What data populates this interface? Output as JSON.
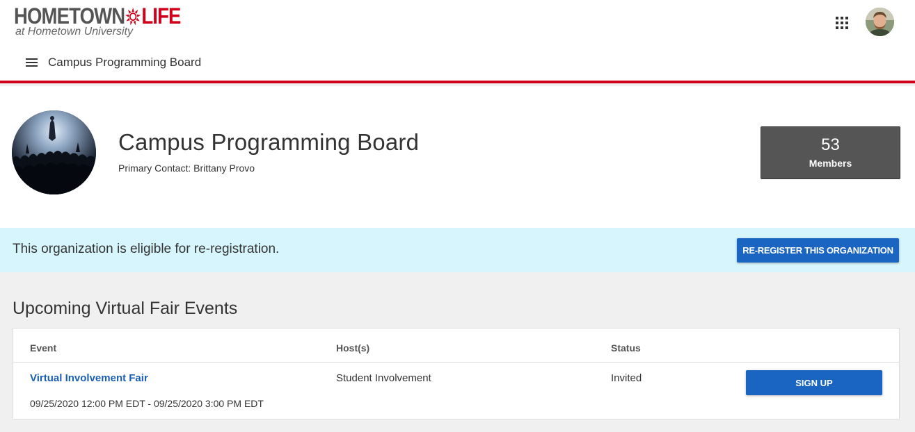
{
  "header": {
    "logo": {
      "word_left": "HOMETOWN",
      "word_right": "LIFE",
      "tagline": "at Hometown University"
    },
    "apps_icon": "grid-apps-icon",
    "avatar_icon": "user-avatar"
  },
  "nav": {
    "menu_icon": "hamburger-menu-icon",
    "title": "Campus Programming Board"
  },
  "organization": {
    "name": "Campus Programming Board",
    "primary_contact": "Primary Contact: Brittany Provo",
    "members": {
      "count": "53",
      "label": "Members"
    }
  },
  "banner": {
    "message": "This organization is eligible for re-registration.",
    "button_label": "RE-REGISTER THIS ORGANIZATION"
  },
  "events": {
    "title": "Upcoming Virtual Fair Events",
    "columns": [
      "Event",
      "Host(s)",
      "Status"
    ],
    "rows": [
      {
        "event": "Virtual Involvement Fair",
        "dates": "09/25/2020 12:00 PM EDT - 09/25/2020 3:00 PM EDT",
        "host": "Student Involvement",
        "status": "Invited",
        "action": "SIGN UP"
      }
    ]
  },
  "colors": {
    "accent_red": "#d0021b",
    "primary_blue": "#1a64c2",
    "banner_bg": "#d6f5fc",
    "members_box": "#555555"
  }
}
